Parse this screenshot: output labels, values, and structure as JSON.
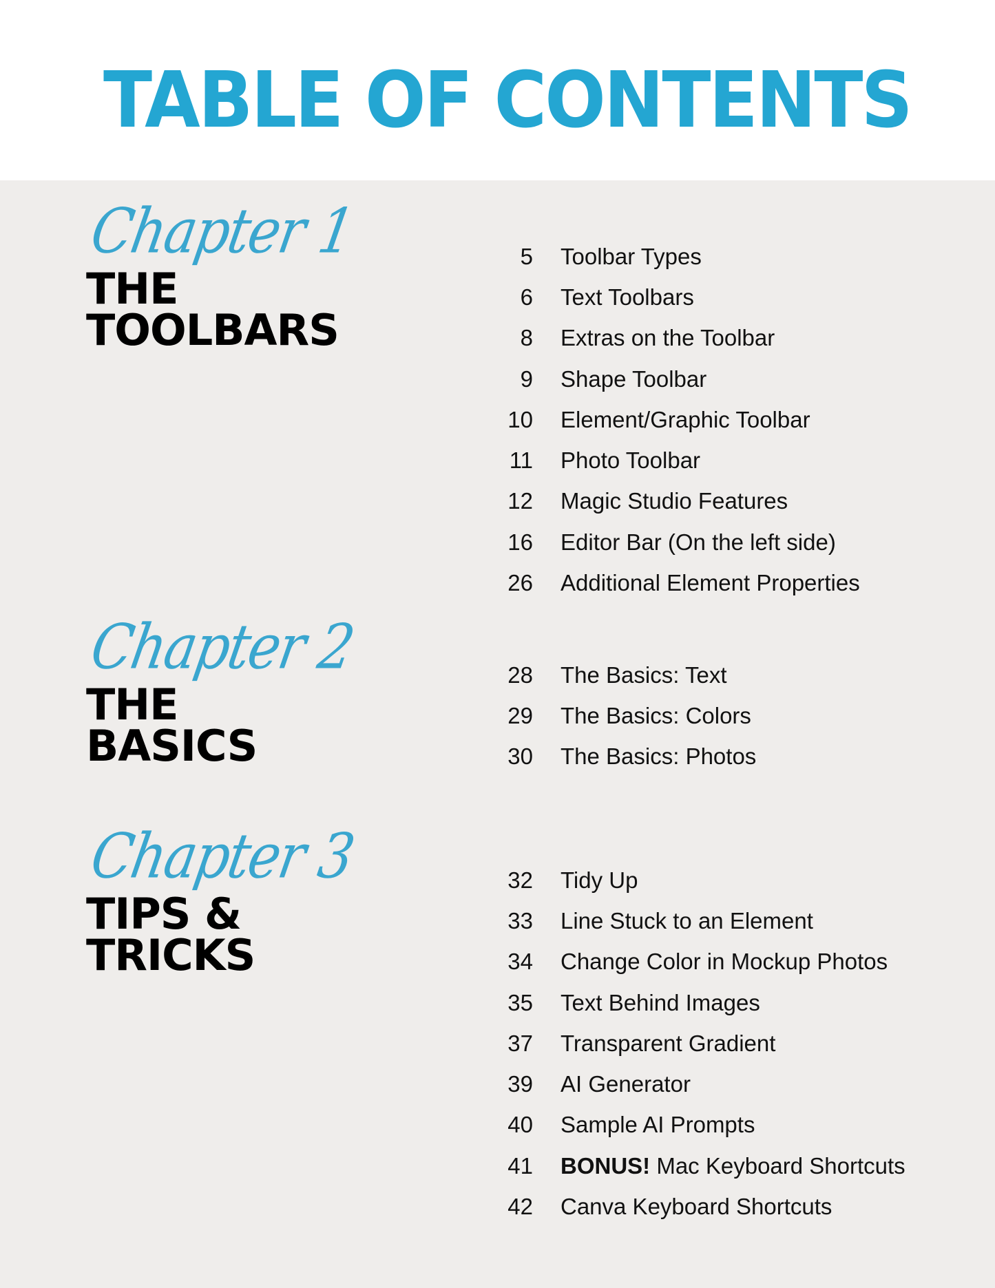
{
  "page": {
    "title": "TABLE OF CONTENTS",
    "colors": {
      "accent": "#24a6d2",
      "background": "#efedeb",
      "header_bg": "#ffffff",
      "text": "#111111"
    }
  },
  "chapters": [
    {
      "script_label": "Chapter 1",
      "title_line1": "THE",
      "title_line2": "TOOLBARS",
      "entries": [
        {
          "page": "5",
          "label": "Toolbar Types"
        },
        {
          "page": "6",
          "label": "Text Toolbars"
        },
        {
          "page": "8",
          "label": "Extras on the Toolbar"
        },
        {
          "page": "9",
          "label": "Shape Toolbar"
        },
        {
          "page": "10",
          "label": "Element/Graphic Toolbar"
        },
        {
          "page": "11",
          "label": "Photo Toolbar"
        },
        {
          "page": "12",
          "label": "Magic Studio Features"
        },
        {
          "page": "16",
          "label": "Editor Bar (On the left side)"
        },
        {
          "page": "26",
          "label": "Additional Element Properties"
        }
      ]
    },
    {
      "script_label": "Chapter 2",
      "title_line1": "THE",
      "title_line2": "BASICS",
      "entries": [
        {
          "page": "28",
          "label": "The Basics: Text"
        },
        {
          "page": "29",
          "label": "The Basics: Colors"
        },
        {
          "page": "30",
          "label": "The Basics: Photos"
        }
      ]
    },
    {
      "script_label": "Chapter 3",
      "title_line1": "TIPS &",
      "title_line2": "TRICKS",
      "entries": [
        {
          "page": "32",
          "label": "Tidy Up"
        },
        {
          "page": "33",
          "label": "Line Stuck to an Element"
        },
        {
          "page": "34",
          "label": "Change Color in Mockup Photos"
        },
        {
          "page": "35",
          "label": "Text Behind Images"
        },
        {
          "page": "37",
          "label": "Transparent Gradient"
        },
        {
          "page": "39",
          "label": "AI Generator"
        },
        {
          "page": "40",
          "label": "Sample AI Prompts"
        },
        {
          "page": "41",
          "bold_prefix": "BONUS!",
          "label": " Mac Keyboard Shortcuts"
        },
        {
          "page": "42",
          "label": "Canva Keyboard Shortcuts"
        }
      ]
    }
  ]
}
